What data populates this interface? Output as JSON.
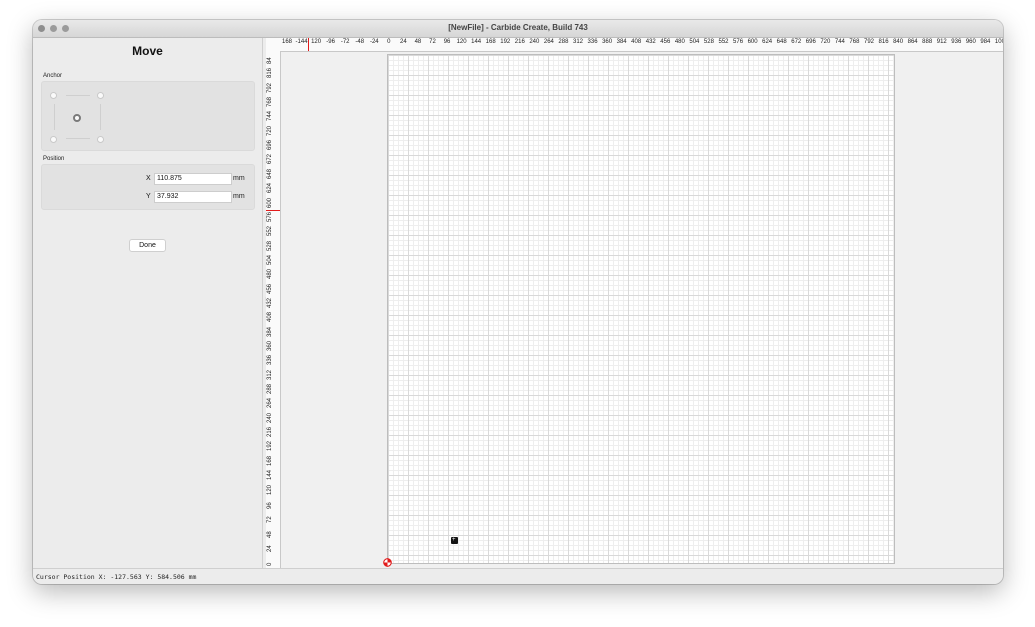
{
  "window": {
    "title": "[NewFile] - Carbide Create, Build 743"
  },
  "panel": {
    "title": "Move",
    "anchor_label": "Anchor",
    "position_label": "Position",
    "x_label": "X",
    "x_value": "110.875",
    "y_label": "Y",
    "y_value": "37.932",
    "unit_x": "mm",
    "unit_y": "mm",
    "done_label": "Done",
    "anchor_selected": "center"
  },
  "ruler_top": {
    "labels": [
      "168",
      "-144",
      "120",
      "-96",
      "-72",
      "-48",
      "-24",
      "0",
      "24",
      "48",
      "72",
      "96",
      "120",
      "144",
      "168",
      "192",
      "216",
      "240",
      "264",
      "288",
      "312",
      "336",
      "360",
      "384",
      "408",
      "432",
      "456",
      "480",
      "504",
      "528",
      "552",
      "576",
      "600",
      "624",
      "648",
      "672",
      "696",
      "720",
      "744",
      "768",
      "792",
      "816",
      "840",
      "864",
      "888",
      "912",
      "936",
      "960",
      "984",
      "100"
    ]
  },
  "ruler_left": {
    "labels": [
      "84",
      "816",
      "792",
      "768",
      "744",
      "720",
      "696",
      "672",
      "648",
      "624",
      "600",
      "576",
      "552",
      "528",
      "504",
      "480",
      "456",
      "432",
      "408",
      "384",
      "360",
      "336",
      "312",
      "288",
      "264",
      "240",
      "216",
      "192",
      "168",
      "144",
      "120",
      "96",
      "72",
      "48",
      "24",
      "0"
    ]
  },
  "status": {
    "cursor_text": "Cursor Position X: -127.563 Y: 584.506 mm"
  },
  "colors": {
    "ruler_cursor": "#e21b1b",
    "origin_red": "#e21b1b",
    "grid_major": "#d9d9d9",
    "grid_minor": "#eeeeee"
  }
}
